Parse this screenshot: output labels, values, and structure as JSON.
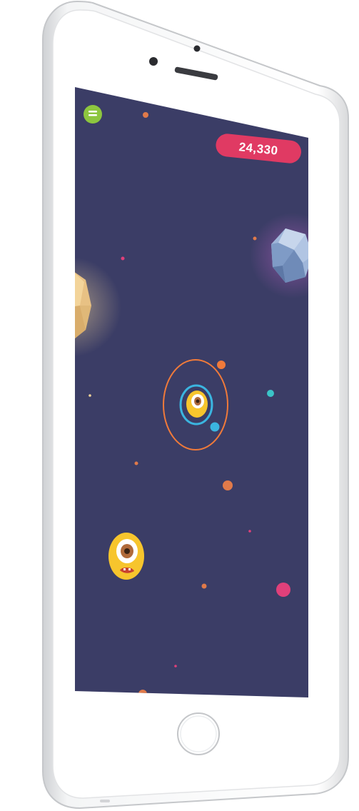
{
  "hud": {
    "score": "24,330",
    "menu_icon": "menu-icon"
  },
  "colors": {
    "space_background": "#3b3d66",
    "score_badge": "#e03a63",
    "menu_button": "#8dc63f",
    "orbit_ring": "#f07a3a",
    "inner_ring": "#3bb5e0",
    "monster_body": "#f7c52d",
    "planet_crystal": "#9fb6d9",
    "planet_gold": "#e8c184",
    "device_frame": "#e8e9eb"
  },
  "icons": {
    "home_button": "home-button-icon",
    "camera": "camera-icon",
    "speaker": "speaker-icon"
  }
}
